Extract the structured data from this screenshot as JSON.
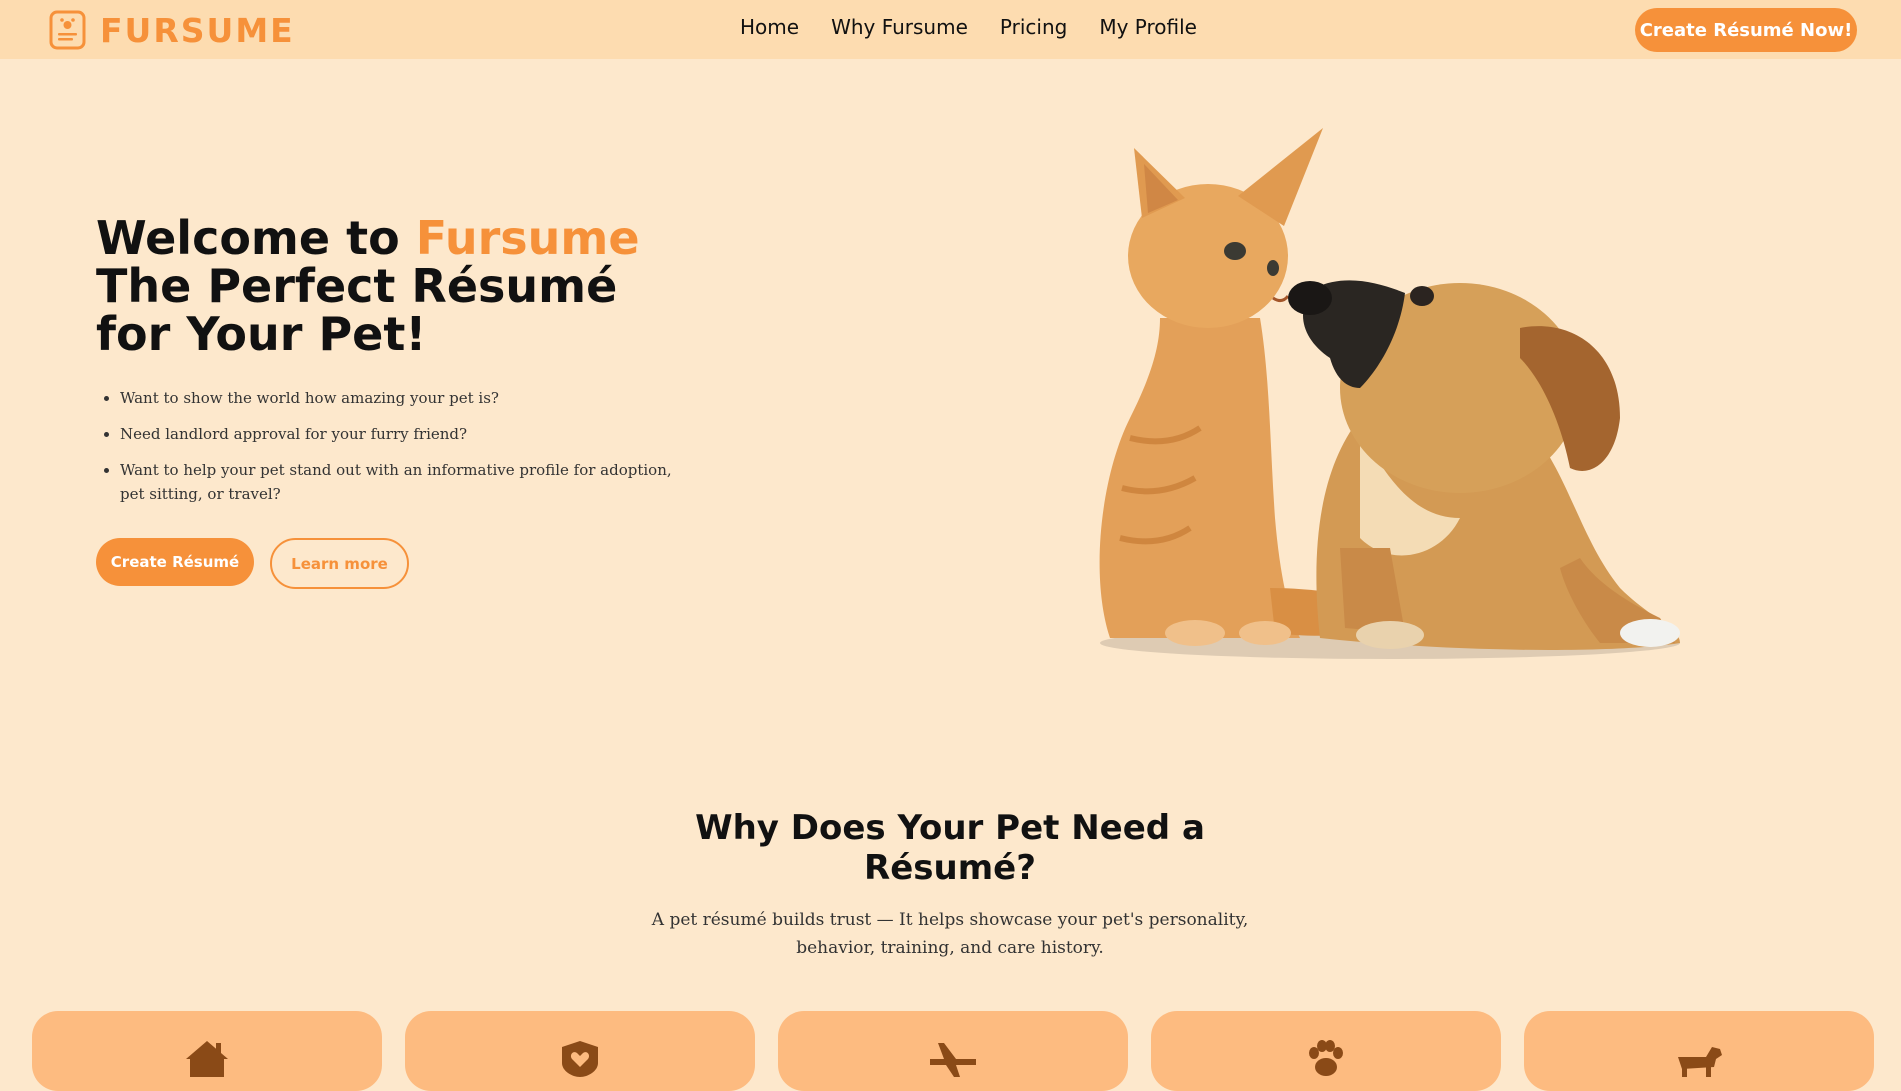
{
  "brand": {
    "name": "FURSUME",
    "accent": "#f6913a",
    "logo_icon": "resume-paw-icon"
  },
  "nav": {
    "links": [
      "Home",
      "Why Fursume",
      "Pricing",
      "My Profile"
    ],
    "cta_label": "Create Résumé Now!"
  },
  "hero": {
    "title_prefix": "Welcome to ",
    "title_brand": "Fursume",
    "title_line2": "The Perfect Résumé",
    "title_line3": "for Your Pet!",
    "bullets": [
      "Want to show the world how amazing your pet is?",
      "Need landlord approval for your furry friend?",
      "Want to help your pet stand out with an informative profile for adoption, pet sitting, or travel?"
    ],
    "primary_button": "Create Résumé",
    "secondary_button": "Learn more",
    "image_alt": "Orange kitten and puppy illustration"
  },
  "why": {
    "title": "Why Does Your Pet Need a Résumé?",
    "subtitle": "A pet résumé builds trust — It helps showcase your pet's personality, behavior, training, and care history.",
    "cards": [
      {
        "icon": "house-icon"
      },
      {
        "icon": "shield-heart-icon"
      },
      {
        "icon": "airplane-icon"
      },
      {
        "icon": "paw-icon"
      },
      {
        "icon": "dog-icon"
      }
    ]
  },
  "colors": {
    "background": "#fde8cc",
    "nav_bg": "#fddcb0",
    "card_bg": "#fdbb80",
    "icon_brown": "#8a4a17"
  }
}
